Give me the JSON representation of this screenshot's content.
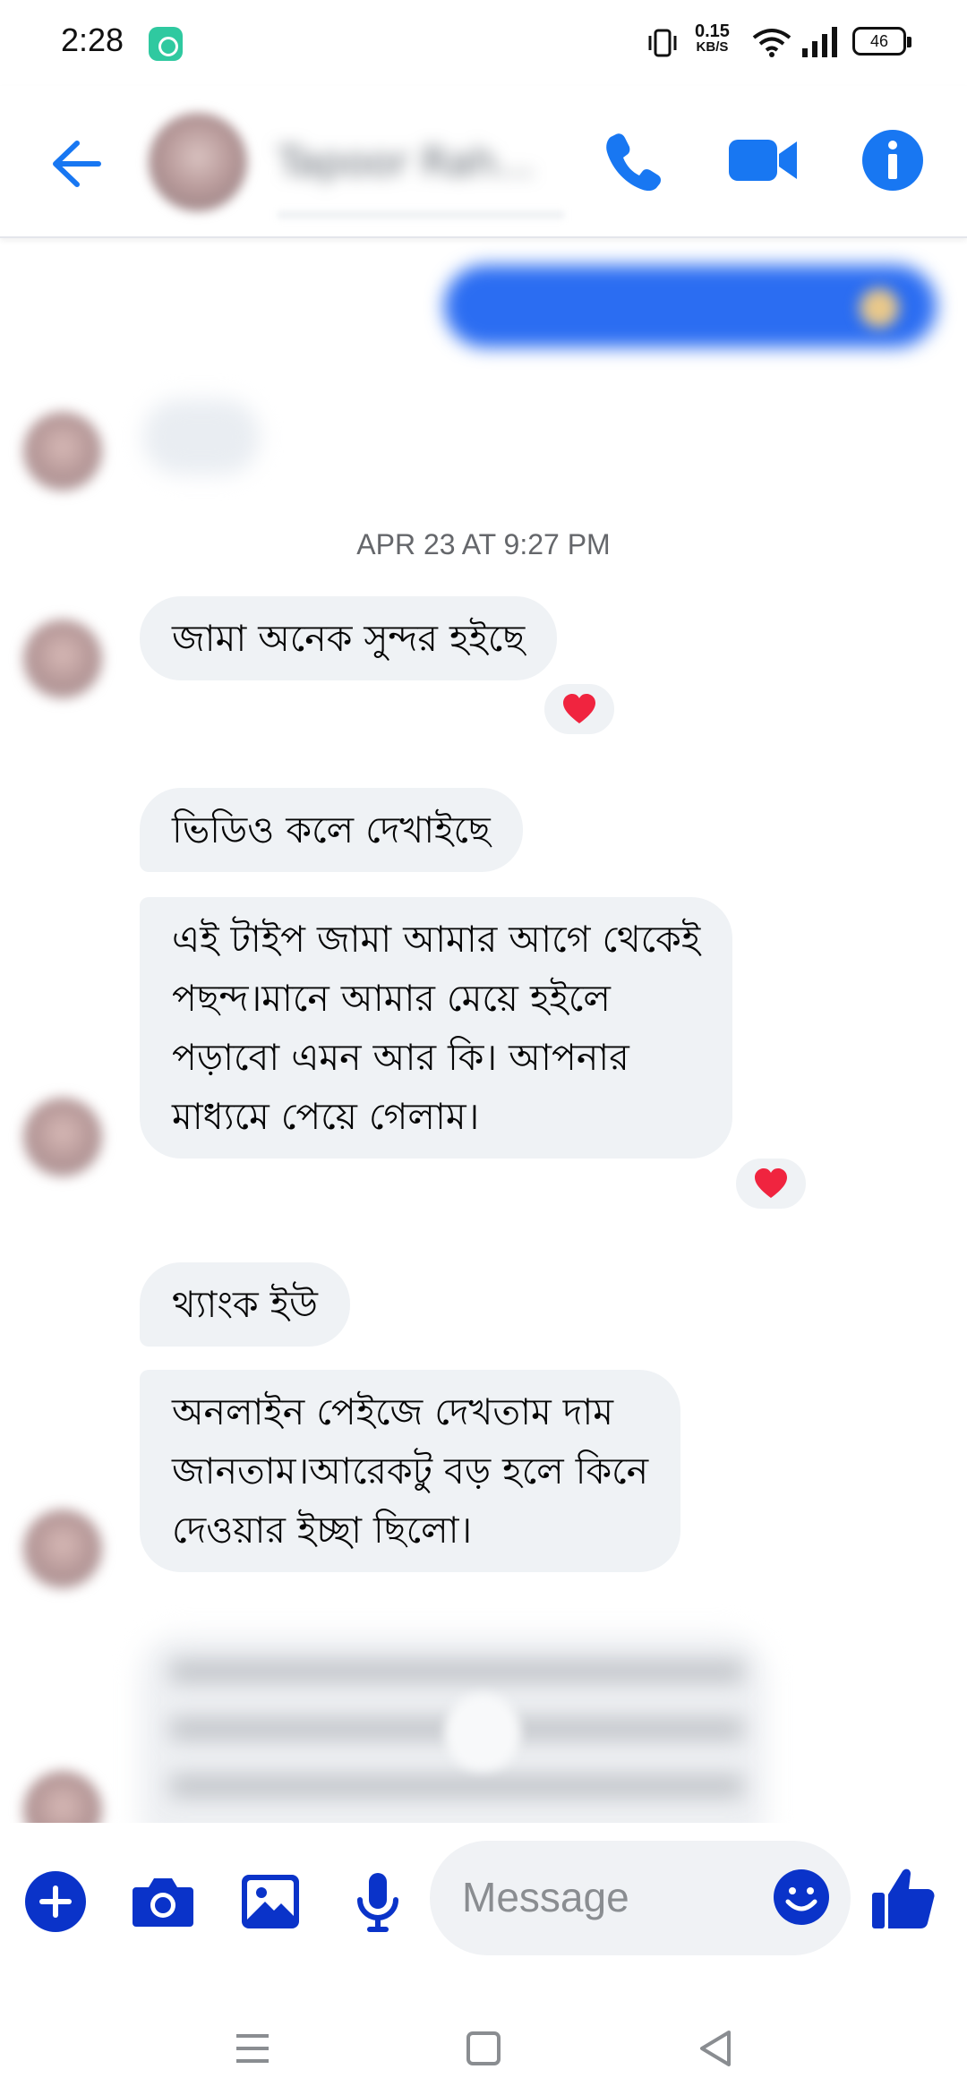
{
  "status_bar": {
    "time": "2:28",
    "net_speed": "0.15",
    "net_unit": "KB/S",
    "battery": "46"
  },
  "header": {
    "contact_name": "Tapoor Rah...",
    "back_icon": "arrow-left-icon",
    "call_icon": "phone-icon",
    "video_icon": "video-camera-icon",
    "info_icon": "info-icon",
    "accent_color": "#1877f2"
  },
  "conversation": {
    "timestamp": "APR 23 AT 9:27 PM",
    "messages": [
      {
        "text": [
          "জামা অনেক সুন্দর হইছে"
        ],
        "reaction": "❤️"
      },
      {
        "text": [
          "ভিডিও কলে দেখাইছে"
        ]
      },
      {
        "text": [
          "এই টাইপ জামা আমার আগে থেকেই",
          "পছন্দ।মানে আমার মেয়ে হইলে",
          "পড়াবো এমন আর কি। আপনার",
          "মাধ্যমে পেয়ে গেলাম।"
        ],
        "reaction": "❤️"
      },
      {
        "text": [
          "থ্যাংক ইউ"
        ]
      },
      {
        "text": [
          "অনলাইন পেইজে দেখতাম দাম",
          "জানতাম।আরেকটু বড় হলে কিনে",
          "দেওয়ার ইচ্ছা ছিলো।"
        ]
      }
    ],
    "bubble_color": "#eff2f5",
    "sent_color": "#2b6df2"
  },
  "composer": {
    "placeholder": "Message",
    "icons": [
      "plus-icon",
      "camera-icon",
      "gallery-icon",
      "microphone-icon",
      "emoji-icon",
      "thumbs-up-icon"
    ],
    "icon_color": "#0a33c9"
  },
  "nav_bar": {
    "icons": [
      "menu-icon",
      "home-square-icon",
      "back-triangle-icon"
    ]
  }
}
